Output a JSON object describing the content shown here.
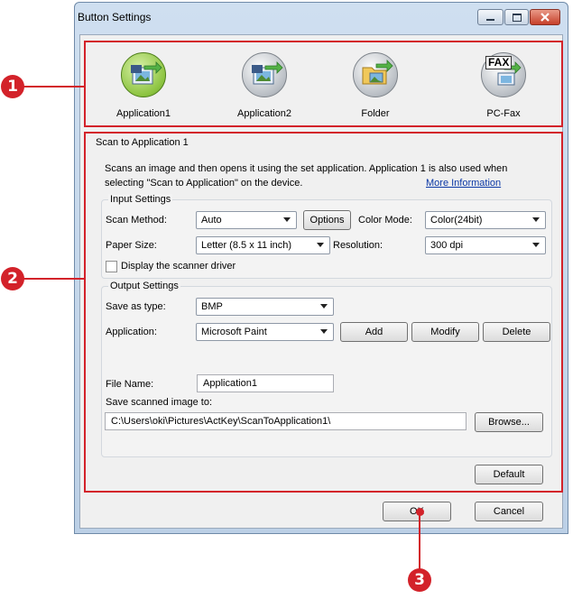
{
  "window": {
    "title": "Button Settings"
  },
  "icons": [
    {
      "label": "Application1",
      "icon": "application-1-icon",
      "selected": true
    },
    {
      "label": "Application2",
      "icon": "application-2-icon",
      "selected": false
    },
    {
      "label": "Folder",
      "icon": "folder-icon",
      "selected": false
    },
    {
      "label": "PC-Fax",
      "icon": "pc-fax-icon",
      "selected": false,
      "badge_text": "FAX"
    }
  ],
  "section": {
    "title": "Scan to Application 1",
    "description_line1": "Scans an image and then opens it using the set application. Application 1 is also used when",
    "description_line2": "selecting \"Scan to Application\" on the device.",
    "more_info": "More Information"
  },
  "input_settings": {
    "title": "Input Settings",
    "scan_method_label": "Scan Method:",
    "scan_method_value": "Auto",
    "options_button": "Options",
    "color_mode_label": "Color Mode:",
    "color_mode_value": "Color(24bit)",
    "paper_size_label": "Paper Size:",
    "paper_size_value": "Letter (8.5 x 11 inch)",
    "resolution_label": "Resolution:",
    "resolution_value": "300 dpi",
    "display_driver_label": "Display the scanner driver",
    "display_driver_checked": false
  },
  "output_settings": {
    "title": "Output Settings",
    "save_as_type_label": "Save as type:",
    "save_as_type_value": "BMP",
    "application_label": "Application:",
    "application_value": "Microsoft Paint",
    "add_button": "Add",
    "modify_button": "Modify",
    "delete_button": "Delete",
    "file_name_label": "File Name:",
    "file_name_value": "Application1",
    "save_to_label": "Save scanned image to:",
    "save_to_value": "C:\\Users\\oki\\Pictures\\ActKey\\ScanToApplication1\\",
    "browse_button": "Browse..."
  },
  "default_button": "Default",
  "ok_button": "OK",
  "cancel_button": "Cancel",
  "callouts": {
    "one": "1",
    "two": "2",
    "three": "3"
  },
  "colors": {
    "callout_red": "#d3222a",
    "selected_green": "#8dc441",
    "link_blue": "#0b38a6"
  }
}
